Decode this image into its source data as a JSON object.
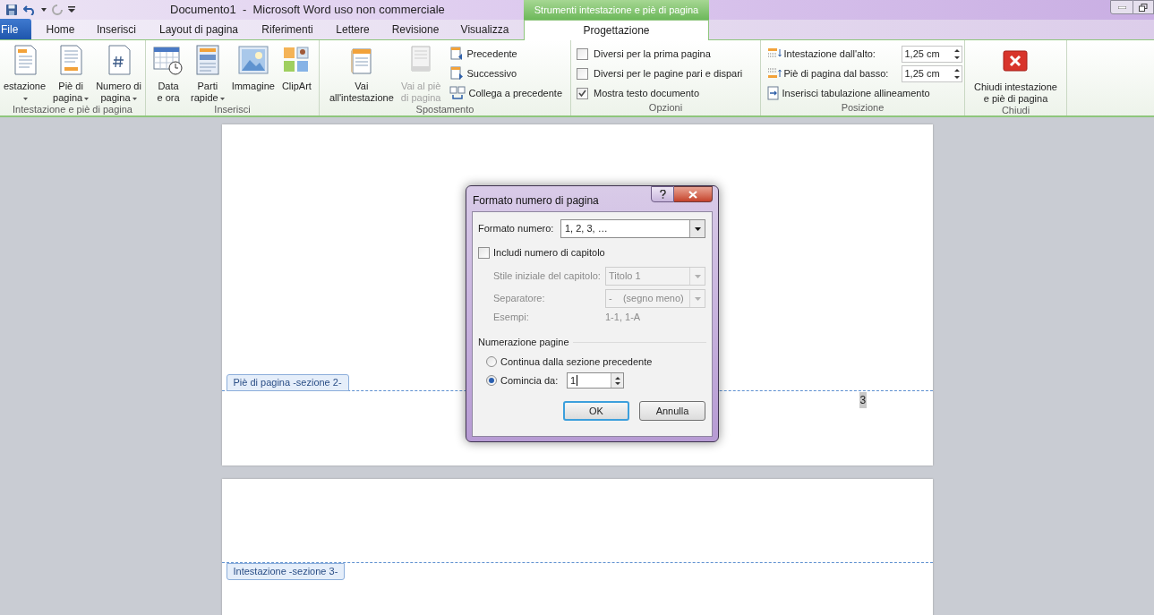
{
  "title_bar": {
    "title": "Documento1  -  Microsoft Word uso non commerciale",
    "context_label": "Strumenti intestazione e piè di pagina"
  },
  "tabs": [
    {
      "label": "File",
      "kind": "file",
      "selected": false
    },
    {
      "label": "Home",
      "kind": "plain",
      "selected": false
    },
    {
      "label": "Inserisci",
      "kind": "plain",
      "selected": false
    },
    {
      "label": "Layout di pagina",
      "kind": "plain",
      "selected": false
    },
    {
      "label": "Riferimenti",
      "kind": "plain",
      "selected": false
    },
    {
      "label": "Lettere",
      "kind": "plain",
      "selected": false
    },
    {
      "label": "Revisione",
      "kind": "plain",
      "selected": false
    },
    {
      "label": "Visualizza",
      "kind": "plain",
      "selected": false
    },
    {
      "label": "Progettazione",
      "kind": "context",
      "selected": true
    }
  ],
  "ribbon_groups": [
    {
      "label": "Intestazione e piè di pagina",
      "items": [
        {
          "kind": "large",
          "lines": [
            "estazione"
          ],
          "dropdown": true,
          "disabled": false
        },
        {
          "kind": "large",
          "lines": [
            "Piè di",
            "pagina"
          ],
          "dropdown": true,
          "disabled": false
        },
        {
          "kind": "large",
          "lines": [
            "Numero di",
            "pagina"
          ],
          "dropdown": true,
          "disabled": false
        }
      ]
    },
    {
      "label": "Inserisci",
      "items": [
        {
          "kind": "large",
          "lines": [
            "Data",
            "e ora"
          ],
          "dropdown": false,
          "disabled": false
        },
        {
          "kind": "large",
          "lines": [
            "Parti",
            "rapide"
          ],
          "dropdown": true,
          "disabled": false
        },
        {
          "kind": "large",
          "lines": [
            "Immagine"
          ],
          "dropdown": false,
          "disabled": false
        },
        {
          "kind": "large",
          "lines": [
            "ClipArt"
          ],
          "dropdown": false,
          "disabled": false
        }
      ]
    },
    {
      "label": "Spostamento",
      "items": [
        {
          "kind": "large",
          "lines": [
            "Vai",
            "all'intestazione"
          ],
          "dropdown": false,
          "disabled": false
        },
        {
          "kind": "large",
          "lines": [
            "Vai al piè",
            "di pagina"
          ],
          "dropdown": false,
          "disabled": true
        },
        {
          "kind": "small",
          "label": "Precedente"
        },
        {
          "kind": "small",
          "label": "Successivo"
        },
        {
          "kind": "small",
          "label": "Collega a precedente"
        }
      ]
    },
    {
      "label": "Opzioni",
      "items": [
        {
          "kind": "checkbox",
          "label": "Diversi per la prima pagina",
          "checked": false
        },
        {
          "kind": "checkbox",
          "label": "Diversi per le pagine pari e dispari",
          "checked": false
        },
        {
          "kind": "checkbox",
          "label": "Mostra testo documento",
          "checked": true
        }
      ]
    },
    {
      "label": "Posizione",
      "items": [
        {
          "kind": "spinner",
          "label": "Intestazione dall'alto:",
          "value": "1,25 cm"
        },
        {
          "kind": "spinner",
          "label": "Piè di pagina dal basso:",
          "value": "1,25 cm"
        },
        {
          "kind": "small",
          "label": "Inserisci tabulazione allineamento"
        }
      ]
    },
    {
      "label": "Chiudi",
      "items": [
        {
          "kind": "close",
          "lines": [
            "Chiudi intestazione",
            "e piè di pagina"
          ],
          "dropdown": false,
          "disabled": false
        }
      ]
    }
  ],
  "document": {
    "footer_tag": "Piè di pagina -sezione 2-",
    "page_number": "3",
    "header_tag": "Intestazione -sezione 3-"
  },
  "dialog": {
    "title": "Formato numero di pagina",
    "format_label": "Formato numero:",
    "format_value": "1, 2, 3, …",
    "include_chapter": {
      "label": "Includi numero di capitolo",
      "checked": false
    },
    "chapter_rows": [
      {
        "kind": "select",
        "label": "Stile iniziale del capitolo:",
        "value": "Titolo 1"
      },
      {
        "kind": "select",
        "label": "Separatore:",
        "value": "-    (segno meno)"
      },
      {
        "kind": "text",
        "label": "Esempi:",
        "value": "1-1, 1-A"
      }
    ],
    "section_label": "Numerazione pagine",
    "radios": [
      {
        "label": "Continua dalla sezione precedente",
        "selected": false
      },
      {
        "label": "Comincia da:",
        "selected": true,
        "value": "1"
      }
    ],
    "buttons": [
      {
        "label": "OK",
        "default": true
      },
      {
        "label": "Annulla",
        "default": false
      }
    ]
  }
}
